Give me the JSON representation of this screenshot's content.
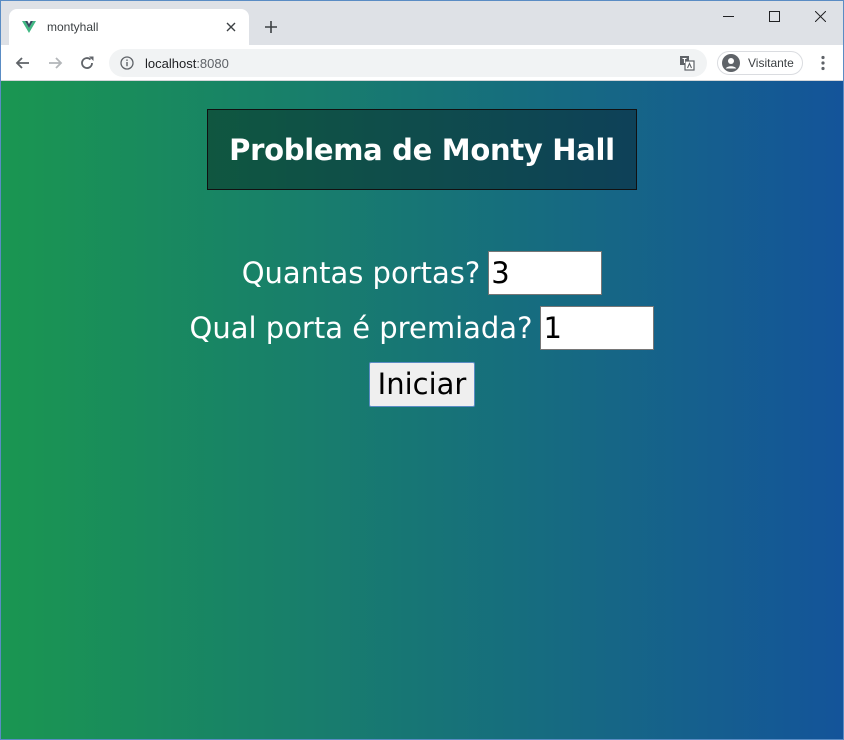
{
  "browser": {
    "tab": {
      "title": "montyhall",
      "close_glyph": "✕",
      "favicon": "vue-logo-icon"
    },
    "new_tab_glyph": "+",
    "window_controls": {
      "minimize": "—",
      "maximize": "☐",
      "close": "✕"
    },
    "address": {
      "host": "localhost",
      "port": ":8080"
    },
    "profile": {
      "label": "Visitante"
    }
  },
  "page": {
    "title": "Problema de Monty Hall",
    "form": {
      "doors_label": "Quantas portas?",
      "doors_value": "3",
      "prize_label": "Qual porta é premiada?",
      "prize_value": "1",
      "start_button": "Iniciar"
    },
    "colors": {
      "gradient_start": "#1a9651",
      "gradient_end": "#14549a"
    }
  }
}
